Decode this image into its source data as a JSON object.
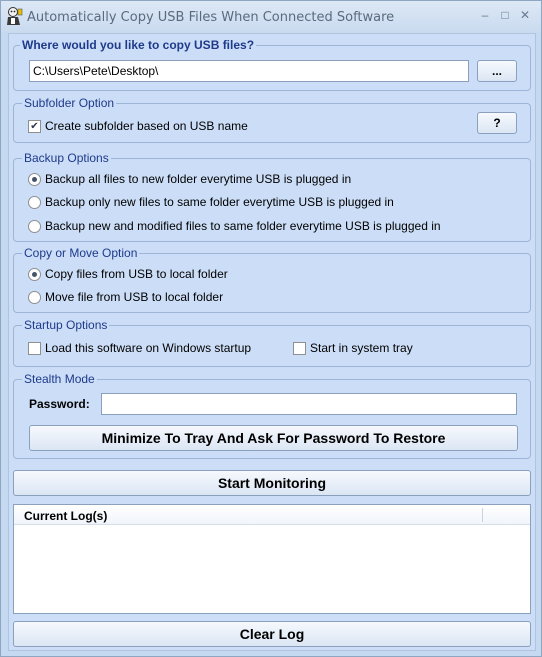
{
  "window": {
    "title": "Automatically Copy USB Files When Connected Software",
    "minimize_glyph": "–",
    "maximize_glyph": "□",
    "close_glyph": "✕"
  },
  "destination": {
    "legend": "Where would you like to copy USB files?",
    "path_value": "C:\\Users\\Pete\\Desktop\\",
    "browse_label": "..."
  },
  "subfolder": {
    "legend": "Subfolder Option",
    "checkbox_label": "Create subfolder based on USB name",
    "checked": true,
    "help_label": "?"
  },
  "backup": {
    "legend": "Backup Options",
    "options": [
      {
        "label": "Backup all files to new folder everytime USB is plugged in",
        "selected": true
      },
      {
        "label": "Backup only new files to same folder everytime USB is plugged in",
        "selected": false
      },
      {
        "label": "Backup new and modified files to same folder everytime USB is plugged in",
        "selected": false
      }
    ]
  },
  "copy_move": {
    "legend": "Copy or Move Option",
    "options": [
      {
        "label": "Copy files from USB to local folder",
        "selected": true
      },
      {
        "label": "Move file from USB to local folder",
        "selected": false
      }
    ]
  },
  "startup": {
    "legend": "Startup Options",
    "load_on_startup_label": "Load this software on Windows startup",
    "load_on_startup_checked": false,
    "system_tray_label": "Start in system tray",
    "system_tray_checked": false
  },
  "stealth": {
    "legend": "Stealth Mode",
    "password_label": "Password:",
    "password_value": "",
    "minimize_label": "Minimize To Tray And Ask For Password To Restore"
  },
  "actions": {
    "start_label": "Start Monitoring",
    "clear_label": "Clear Log"
  },
  "log": {
    "column_header": "Current Log(s)",
    "entries": []
  },
  "colors": {
    "window_bg": "#c5d9f1",
    "client_bg": "#ccdef7",
    "legend_text": "#1e3a8a",
    "border": "#9db5d6"
  }
}
